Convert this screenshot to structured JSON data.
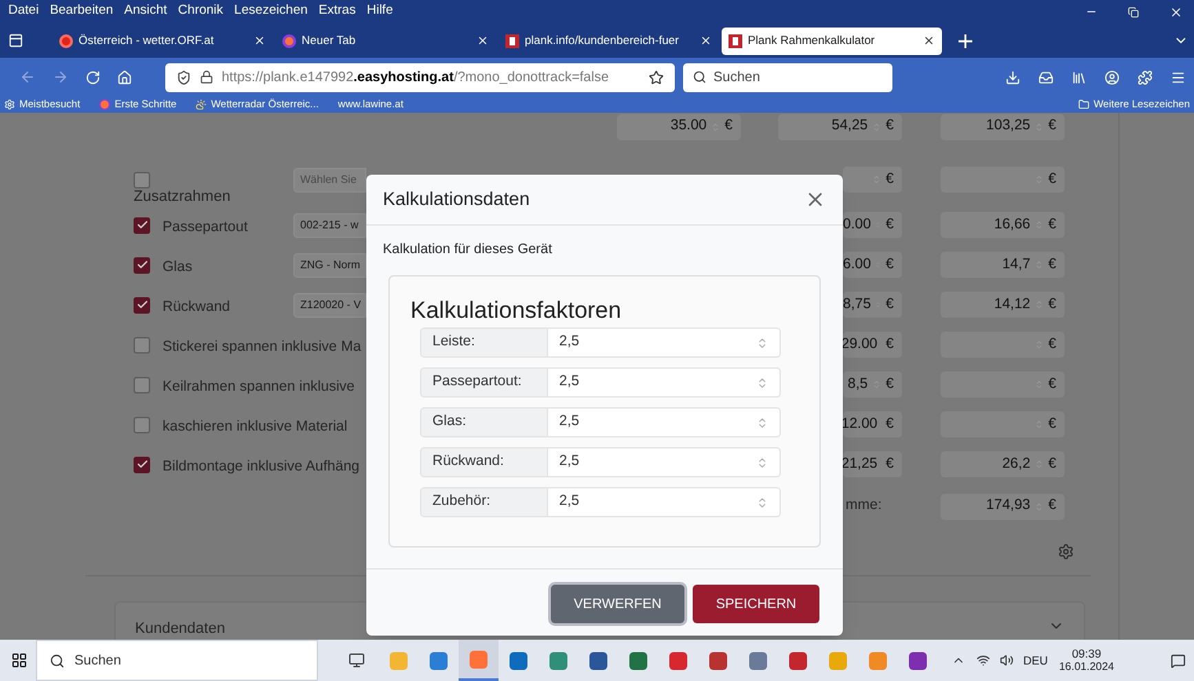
{
  "menu_bar": {
    "items": [
      "Datei",
      "Bearbeiten",
      "Ansicht",
      "Chronik",
      "Lesezeichen",
      "Extras",
      "Hilfe"
    ]
  },
  "tabs": [
    {
      "title": "Österreich - wetter.ORF.at",
      "kind": "target",
      "selected": false
    },
    {
      "title": "Neuer Tab",
      "kind": "fox",
      "selected": false
    },
    {
      "title": "plank.info/kundenbereich-fuer",
      "kind": "square",
      "selected": false
    },
    {
      "title": "Plank Rahmenkalkulator",
      "kind": "square",
      "selected": true
    }
  ],
  "toolbar": {
    "url": "https://plank.e147992**.easyhosting.at**/?mono_donottrack=false",
    "search_placeholder": "Suchen"
  },
  "bookmarks": {
    "items": [
      {
        "label": "Meistbesucht",
        "kind": "gear"
      },
      {
        "label": "Erste Schritte",
        "kind": "fox"
      },
      {
        "label": "Wetterradar Österreic...",
        "kind": "weather"
      },
      {
        "label": "www.lawine.at",
        "kind": "none"
      }
    ],
    "more": "Weitere Lesezeichen"
  },
  "page": {
    "top_prices": [
      {
        "value": "35.00",
        "unit": "€"
      },
      {
        "value": "54,25",
        "unit": "€"
      },
      {
        "value": "103,25",
        "unit": "€"
      }
    ],
    "rows": [
      {
        "kind": "option",
        "checked": false,
        "placeholder": "Wählen Sie",
        "prices": [
          {
            "unit": "€"
          },
          {
            "unit": "€"
          }
        ]
      },
      {
        "kind": "heading",
        "label": "Zusatzrahmen"
      },
      {
        "kind": "option",
        "checked": true,
        "label": "Passepartout",
        "select": "002-215 - w",
        "prices": [
          {
            "value": "0.00",
            "unit": "€"
          },
          {
            "value": "16,66",
            "unit": "€"
          }
        ]
      },
      {
        "kind": "option",
        "checked": true,
        "label": "Glas",
        "select": "ZNG - Norm",
        "prices": [
          {
            "value": "6.00",
            "unit": "€"
          },
          {
            "value": "14,7",
            "unit": "€"
          }
        ]
      },
      {
        "kind": "option",
        "checked": true,
        "label": "Rückwand",
        "select": "Z120020 - V",
        "prices": [
          {
            "value": "8,75",
            "unit": "€"
          },
          {
            "value": "14,12",
            "unit": "€"
          }
        ]
      },
      {
        "kind": "option",
        "checked": false,
        "label": "Stickerei spannen inklusive Ma",
        "prices": [
          {
            "value": "29.00",
            "unit": "€"
          },
          {
            "unit": "€"
          }
        ]
      },
      {
        "kind": "option",
        "checked": false,
        "label": "Keilrahmen spannen inklusive",
        "prices": [
          {
            "value": "8,5",
            "unit": "€"
          },
          {
            "unit": "€"
          }
        ]
      },
      {
        "kind": "option",
        "checked": false,
        "label": "kaschieren inklusive Material",
        "prices": [
          {
            "value": "12.00",
            "unit": "€"
          },
          {
            "unit": "€"
          }
        ]
      },
      {
        "kind": "option",
        "checked": true,
        "label": "Bildmontage inklusive Aufhäng",
        "prices": [
          {
            "value": "21,25",
            "unit": "€"
          },
          {
            "value": "26,2",
            "unit": "€"
          }
        ]
      }
    ],
    "sum": {
      "label": "mme:",
      "value": "174,93",
      "unit": "€"
    },
    "section": "Kundendaten"
  },
  "dialog": {
    "title": "Kalkulationsdaten",
    "subtitle": "Kalkulation für dieses Gerät",
    "card_title": "Kalkulationsfaktoren",
    "factors": [
      {
        "label": "Leiste:",
        "value": "2,5"
      },
      {
        "label": "Passepartout:",
        "value": "2,5"
      },
      {
        "label": "Glas:",
        "value": "2,5"
      },
      {
        "label": "Rückwand:",
        "value": "2,5"
      },
      {
        "label": "Zubehör:",
        "value": "2,5"
      }
    ],
    "buttons": [
      {
        "label": "VERWERFEN",
        "kind": "secondary"
      },
      {
        "label": "SPEICHERN",
        "kind": "primary"
      }
    ]
  },
  "taskbar": {
    "search_placeholder": "Suchen",
    "apps": [
      {
        "color": "#f2b632",
        "selected": false
      },
      {
        "color": "#2a7fd4",
        "selected": false
      },
      {
        "color": "#ff7139",
        "selected": true
      },
      {
        "color": "#0f6cbd",
        "selected": false
      },
      {
        "color": "#2f8f78",
        "selected": false
      },
      {
        "color": "#2b579a",
        "selected": false
      },
      {
        "color": "#217346",
        "selected": false
      },
      {
        "color": "#d6282e",
        "selected": false
      },
      {
        "color": "#b8322f",
        "selected": false
      },
      {
        "color": "#6a7b9a",
        "selected": false
      },
      {
        "color": "#c4262e",
        "selected": false
      },
      {
        "color": "#e8a90b",
        "selected": false
      },
      {
        "color": "#f08a24",
        "selected": false
      },
      {
        "color": "#7d2fb0",
        "selected": false
      }
    ],
    "language": "DEU",
    "time": "09:39",
    "date": "16.01.2024"
  }
}
